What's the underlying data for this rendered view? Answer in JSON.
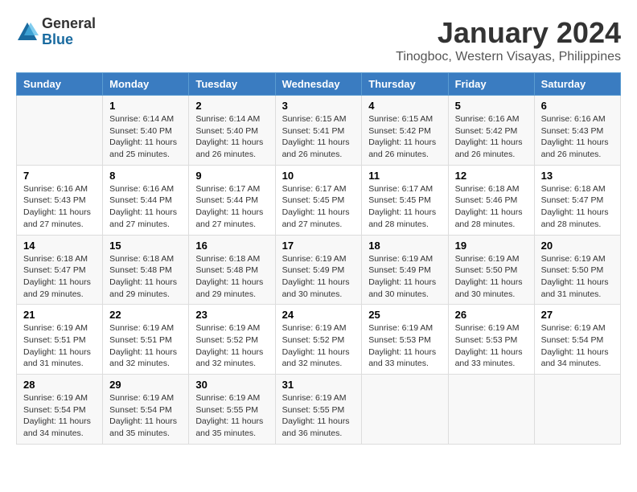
{
  "logo": {
    "general": "General",
    "blue": "Blue"
  },
  "title": "January 2024",
  "subtitle": "Tinogboc, Western Visayas, Philippines",
  "days_of_week": [
    "Sunday",
    "Monday",
    "Tuesday",
    "Wednesday",
    "Thursday",
    "Friday",
    "Saturday"
  ],
  "weeks": [
    [
      {
        "num": "",
        "sunrise": "",
        "sunset": "",
        "daylight": ""
      },
      {
        "num": "1",
        "sunrise": "Sunrise: 6:14 AM",
        "sunset": "Sunset: 5:40 PM",
        "daylight": "Daylight: 11 hours and 25 minutes."
      },
      {
        "num": "2",
        "sunrise": "Sunrise: 6:14 AM",
        "sunset": "Sunset: 5:40 PM",
        "daylight": "Daylight: 11 hours and 26 minutes."
      },
      {
        "num": "3",
        "sunrise": "Sunrise: 6:15 AM",
        "sunset": "Sunset: 5:41 PM",
        "daylight": "Daylight: 11 hours and 26 minutes."
      },
      {
        "num": "4",
        "sunrise": "Sunrise: 6:15 AM",
        "sunset": "Sunset: 5:42 PM",
        "daylight": "Daylight: 11 hours and 26 minutes."
      },
      {
        "num": "5",
        "sunrise": "Sunrise: 6:16 AM",
        "sunset": "Sunset: 5:42 PM",
        "daylight": "Daylight: 11 hours and 26 minutes."
      },
      {
        "num": "6",
        "sunrise": "Sunrise: 6:16 AM",
        "sunset": "Sunset: 5:43 PM",
        "daylight": "Daylight: 11 hours and 26 minutes."
      }
    ],
    [
      {
        "num": "7",
        "sunrise": "Sunrise: 6:16 AM",
        "sunset": "Sunset: 5:43 PM",
        "daylight": "Daylight: 11 hours and 27 minutes."
      },
      {
        "num": "8",
        "sunrise": "Sunrise: 6:16 AM",
        "sunset": "Sunset: 5:44 PM",
        "daylight": "Daylight: 11 hours and 27 minutes."
      },
      {
        "num": "9",
        "sunrise": "Sunrise: 6:17 AM",
        "sunset": "Sunset: 5:44 PM",
        "daylight": "Daylight: 11 hours and 27 minutes."
      },
      {
        "num": "10",
        "sunrise": "Sunrise: 6:17 AM",
        "sunset": "Sunset: 5:45 PM",
        "daylight": "Daylight: 11 hours and 27 minutes."
      },
      {
        "num": "11",
        "sunrise": "Sunrise: 6:17 AM",
        "sunset": "Sunset: 5:45 PM",
        "daylight": "Daylight: 11 hours and 28 minutes."
      },
      {
        "num": "12",
        "sunrise": "Sunrise: 6:18 AM",
        "sunset": "Sunset: 5:46 PM",
        "daylight": "Daylight: 11 hours and 28 minutes."
      },
      {
        "num": "13",
        "sunrise": "Sunrise: 6:18 AM",
        "sunset": "Sunset: 5:47 PM",
        "daylight": "Daylight: 11 hours and 28 minutes."
      }
    ],
    [
      {
        "num": "14",
        "sunrise": "Sunrise: 6:18 AM",
        "sunset": "Sunset: 5:47 PM",
        "daylight": "Daylight: 11 hours and 29 minutes."
      },
      {
        "num": "15",
        "sunrise": "Sunrise: 6:18 AM",
        "sunset": "Sunset: 5:48 PM",
        "daylight": "Daylight: 11 hours and 29 minutes."
      },
      {
        "num": "16",
        "sunrise": "Sunrise: 6:18 AM",
        "sunset": "Sunset: 5:48 PM",
        "daylight": "Daylight: 11 hours and 29 minutes."
      },
      {
        "num": "17",
        "sunrise": "Sunrise: 6:19 AM",
        "sunset": "Sunset: 5:49 PM",
        "daylight": "Daylight: 11 hours and 30 minutes."
      },
      {
        "num": "18",
        "sunrise": "Sunrise: 6:19 AM",
        "sunset": "Sunset: 5:49 PM",
        "daylight": "Daylight: 11 hours and 30 minutes."
      },
      {
        "num": "19",
        "sunrise": "Sunrise: 6:19 AM",
        "sunset": "Sunset: 5:50 PM",
        "daylight": "Daylight: 11 hours and 30 minutes."
      },
      {
        "num": "20",
        "sunrise": "Sunrise: 6:19 AM",
        "sunset": "Sunset: 5:50 PM",
        "daylight": "Daylight: 11 hours and 31 minutes."
      }
    ],
    [
      {
        "num": "21",
        "sunrise": "Sunrise: 6:19 AM",
        "sunset": "Sunset: 5:51 PM",
        "daylight": "Daylight: 11 hours and 31 minutes."
      },
      {
        "num": "22",
        "sunrise": "Sunrise: 6:19 AM",
        "sunset": "Sunset: 5:51 PM",
        "daylight": "Daylight: 11 hours and 32 minutes."
      },
      {
        "num": "23",
        "sunrise": "Sunrise: 6:19 AM",
        "sunset": "Sunset: 5:52 PM",
        "daylight": "Daylight: 11 hours and 32 minutes."
      },
      {
        "num": "24",
        "sunrise": "Sunrise: 6:19 AM",
        "sunset": "Sunset: 5:52 PM",
        "daylight": "Daylight: 11 hours and 32 minutes."
      },
      {
        "num": "25",
        "sunrise": "Sunrise: 6:19 AM",
        "sunset": "Sunset: 5:53 PM",
        "daylight": "Daylight: 11 hours and 33 minutes."
      },
      {
        "num": "26",
        "sunrise": "Sunrise: 6:19 AM",
        "sunset": "Sunset: 5:53 PM",
        "daylight": "Daylight: 11 hours and 33 minutes."
      },
      {
        "num": "27",
        "sunrise": "Sunrise: 6:19 AM",
        "sunset": "Sunset: 5:54 PM",
        "daylight": "Daylight: 11 hours and 34 minutes."
      }
    ],
    [
      {
        "num": "28",
        "sunrise": "Sunrise: 6:19 AM",
        "sunset": "Sunset: 5:54 PM",
        "daylight": "Daylight: 11 hours and 34 minutes."
      },
      {
        "num": "29",
        "sunrise": "Sunrise: 6:19 AM",
        "sunset": "Sunset: 5:54 PM",
        "daylight": "Daylight: 11 hours and 35 minutes."
      },
      {
        "num": "30",
        "sunrise": "Sunrise: 6:19 AM",
        "sunset": "Sunset: 5:55 PM",
        "daylight": "Daylight: 11 hours and 35 minutes."
      },
      {
        "num": "31",
        "sunrise": "Sunrise: 6:19 AM",
        "sunset": "Sunset: 5:55 PM",
        "daylight": "Daylight: 11 hours and 36 minutes."
      },
      {
        "num": "",
        "sunrise": "",
        "sunset": "",
        "daylight": ""
      },
      {
        "num": "",
        "sunrise": "",
        "sunset": "",
        "daylight": ""
      },
      {
        "num": "",
        "sunrise": "",
        "sunset": "",
        "daylight": ""
      }
    ]
  ]
}
